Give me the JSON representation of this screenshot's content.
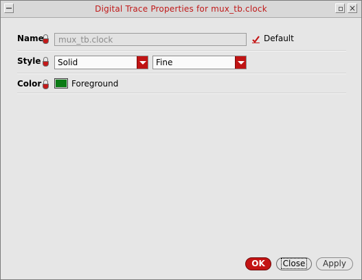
{
  "window": {
    "title": "Digital Trace Properties for mux_tb.clock"
  },
  "form": {
    "name": {
      "label": "Name",
      "value": "mux_tb.clock",
      "default_checked": true,
      "default_label": "Default"
    },
    "style": {
      "label": "Style",
      "line_style": "Solid",
      "line_weight": "Fine"
    },
    "color": {
      "label": "Color",
      "swatch_color": "#0a7a14",
      "value": "Foreground"
    }
  },
  "buttons": {
    "ok": "OK",
    "close": "Close",
    "apply": "Apply"
  },
  "colors": {
    "accent": "#c41414",
    "title_text": "#c01818"
  }
}
